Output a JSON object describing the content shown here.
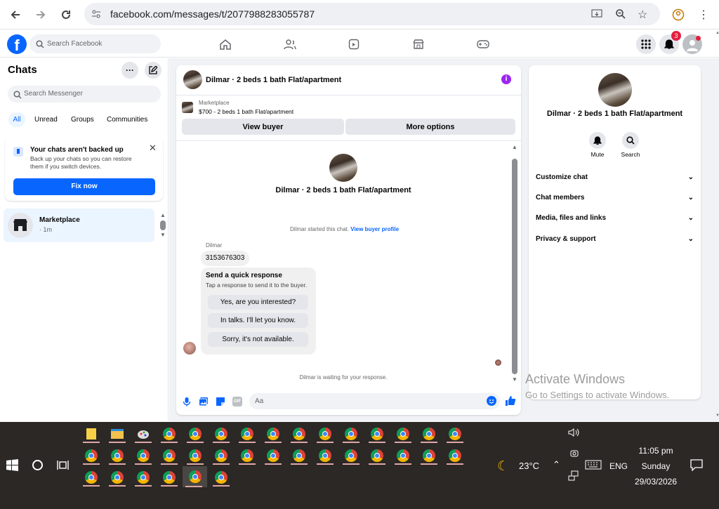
{
  "browser": {
    "url": "facebook.com/messages/t/2077988283055787"
  },
  "fb": {
    "search_placeholder": "Search Facebook",
    "notification_count": "3"
  },
  "chats": {
    "title": "Chats",
    "search_placeholder": "Search Messenger",
    "filters": [
      "All",
      "Unread",
      "Groups",
      "Communities"
    ],
    "backup": {
      "title": "Your chats aren't backed up",
      "body": "Back up your chats so you can restore them if you switch devices.",
      "button": "Fix now"
    },
    "items": [
      {
        "name": "Marketplace",
        "time": "· 1m"
      }
    ]
  },
  "conversation": {
    "title": "Dilmar · 2 beds 1 bath Flat/apartment",
    "listing_source": "Marketplace",
    "listing": "$700 - 2 beds 1 bath Flat/apartment",
    "view_buyer": "View buyer",
    "more_options": "More options",
    "started_text": "Dilmar started this chat.",
    "view_profile": "View buyer profile",
    "sender": "Dilmar",
    "message": "3153676303",
    "quick_title": "Send a quick response",
    "quick_sub": "Tap a response to send it to the buyer.",
    "quick_replies": [
      "Yes, are you interested?",
      "In talks. I'll let you know.",
      "Sorry, it's not available."
    ],
    "waiting": "Dilmar is waiting for your response.",
    "input_placeholder": "Aa"
  },
  "details": {
    "title": "Dilmar · 2 beds 1 bath Flat/apartment",
    "mute": "Mute",
    "search": "Search",
    "sections": [
      "Customize chat",
      "Chat members",
      "Media, files and links",
      "Privacy & support"
    ]
  },
  "watermark": {
    "line1": "Activate Windows",
    "line2": "Go to Settings to activate Windows."
  },
  "taskbar": {
    "temp": "23°C",
    "lang": "ENG",
    "time": "11:05 pm",
    "day": "Sunday",
    "date": "29/03/2026"
  },
  "colors": {
    "fb_blue": "#0866ff",
    "taskbar": "#2b2826"
  }
}
